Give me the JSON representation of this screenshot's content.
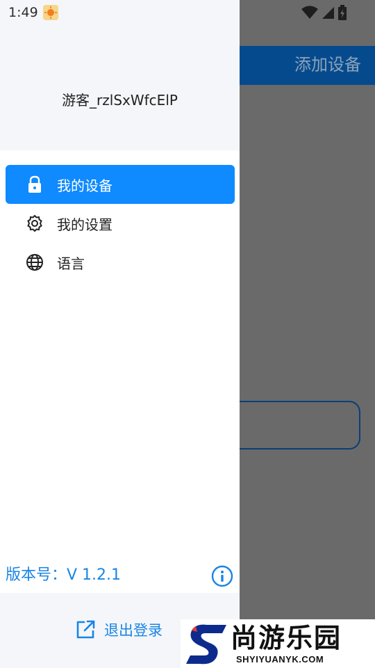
{
  "status_bar": {
    "time": "1:49"
  },
  "background": {
    "add_device_label": "添加设备"
  },
  "drawer": {
    "username": "游客_rzlSxWfcElP",
    "menu": [
      {
        "label": "我的设备",
        "icon": "lock-icon",
        "active": true
      },
      {
        "label": "我的设置",
        "icon": "gear-icon",
        "active": false
      },
      {
        "label": "语言",
        "icon": "globe-icon",
        "active": false
      }
    ],
    "version_text": "版本号：V 1.2.1",
    "logout_label": "退出登录"
  },
  "watermark": {
    "cn": "尚游乐园",
    "en": "SHYIYUANYK.COM"
  },
  "colors": {
    "accent": "#0f8aff",
    "link": "#1985e6",
    "appbar": "#064a8e"
  }
}
